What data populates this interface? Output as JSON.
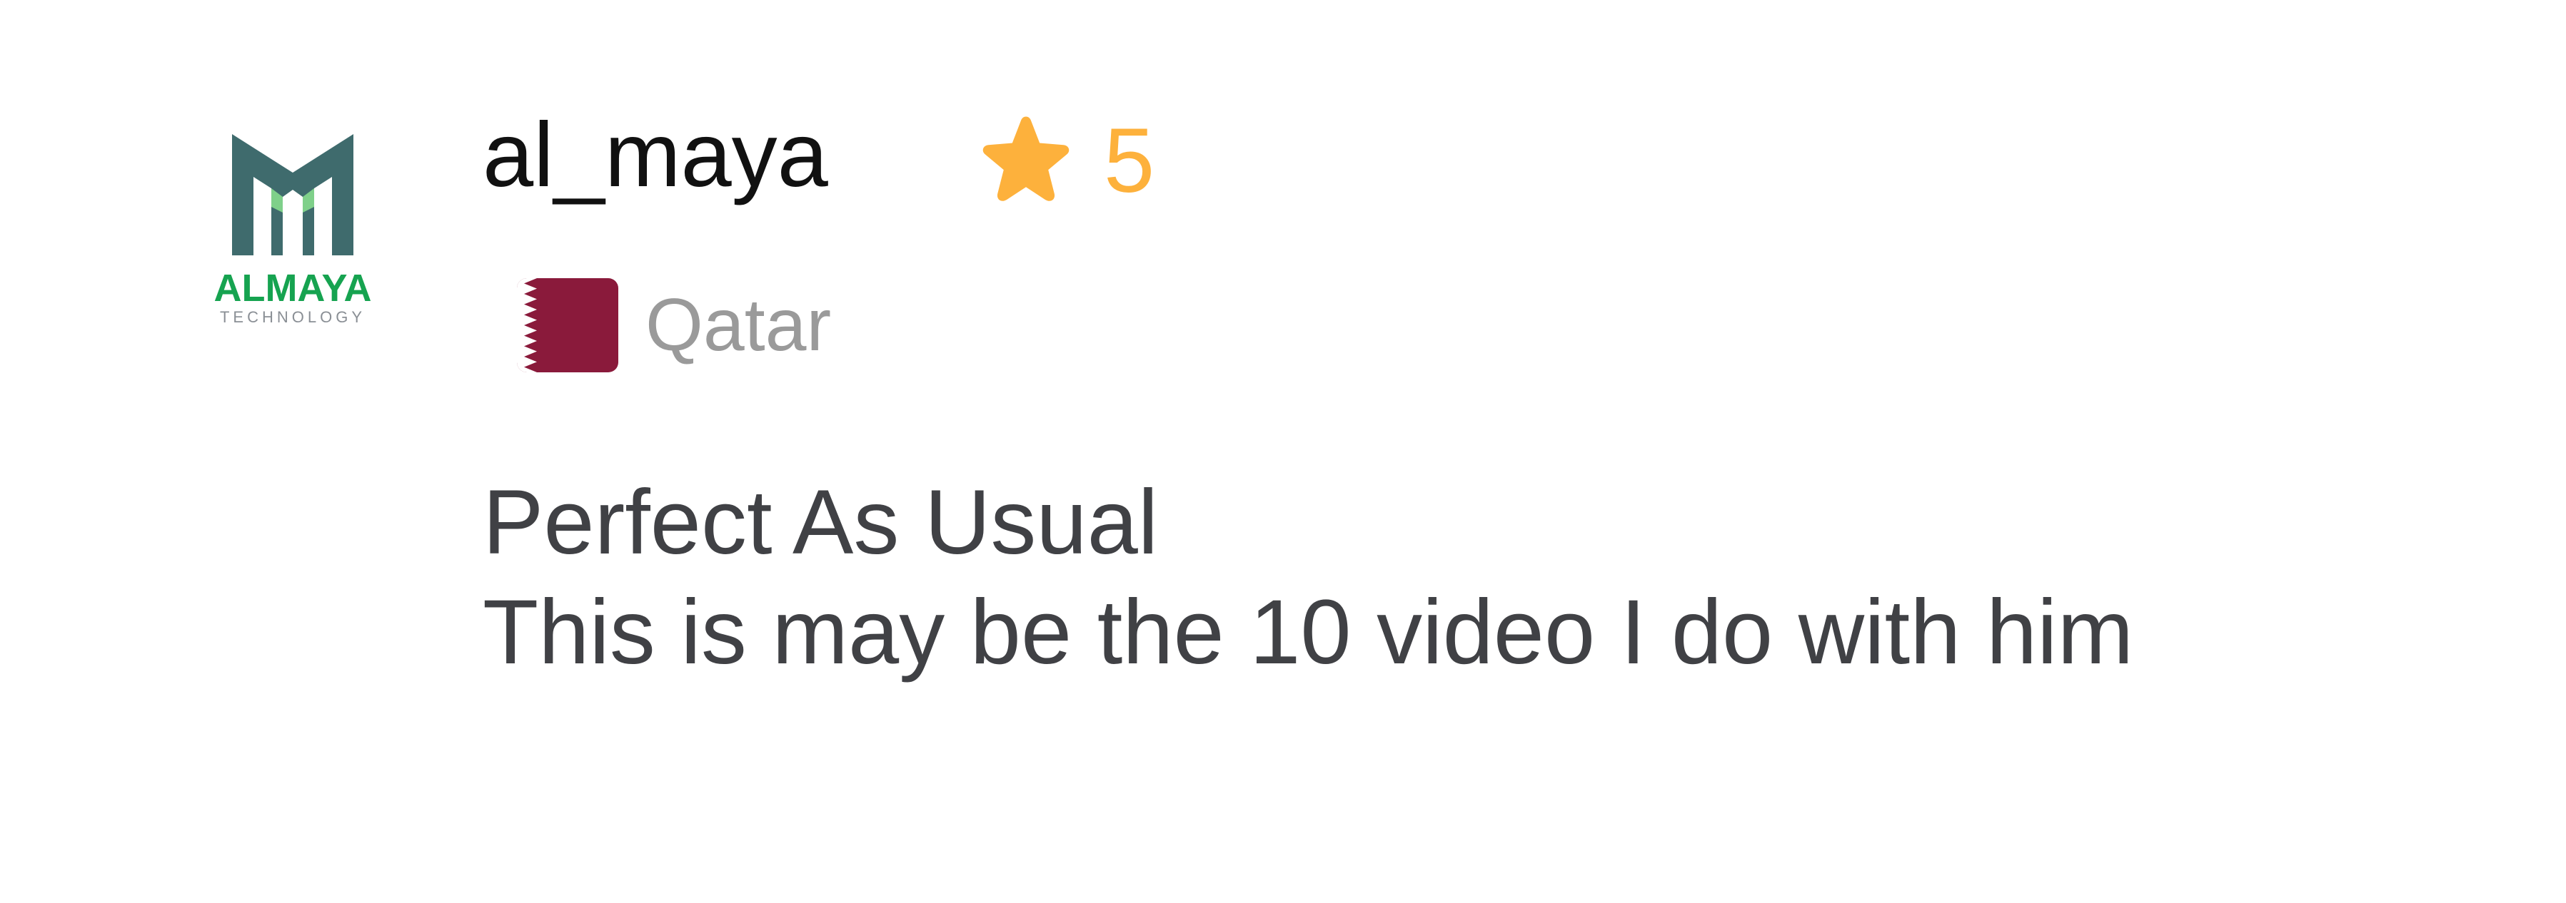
{
  "review": {
    "avatar": {
      "icon": "almaya-logo-icon",
      "brand_name": "ALMAYA",
      "brand_tagline": "TECHNOLOGY",
      "colors": {
        "dark_teal": "#3f6b6d",
        "green": "#16a350",
        "gray": "#8a8f95"
      }
    },
    "username": "al_maya",
    "rating": {
      "value": "5",
      "icon": "star-icon",
      "color": "#fdb13c"
    },
    "country": {
      "name": "Qatar",
      "flag_icon": "qatar-flag-icon",
      "flag_color": "#8a1a3b"
    },
    "text_lines": [
      "Perfect As Usual",
      "This is may be the 10 video I do with him"
    ]
  }
}
